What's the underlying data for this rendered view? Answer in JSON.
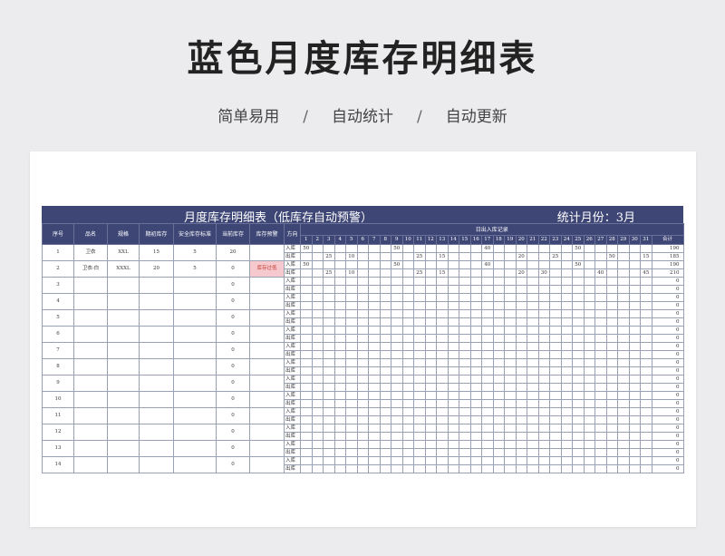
{
  "page": {
    "title": "蓝色月度库存明细表",
    "tagline": [
      "简单易用",
      "自动统计",
      "自动更新"
    ],
    "tagline_sep": "/"
  },
  "sheet": {
    "banner_title": "月度库存明细表（低库存自动预警）",
    "banner_month": "统计月份：3月",
    "headers": {
      "seq": "序号",
      "name": "品名",
      "spec": "规格",
      "initial": "期初库存",
      "safety": "安全库存标准",
      "current": "当前库存",
      "warning": "库存预警",
      "direction": "方向",
      "records": "日出入库记录",
      "total": "合计"
    },
    "days": [
      "1",
      "2",
      "3",
      "4",
      "5",
      "6",
      "7",
      "8",
      "9",
      "10",
      "11",
      "12",
      "13",
      "14",
      "15",
      "16",
      "17",
      "18",
      "19",
      "20",
      "21",
      "22",
      "23",
      "24",
      "25",
      "26",
      "27",
      "28",
      "29",
      "30",
      "31"
    ],
    "dir_labels": [
      "入库",
      "出库"
    ],
    "items": [
      {
        "seq": "1",
        "name": "卫衣",
        "spec": "XXL",
        "initial": "15",
        "safety": "5",
        "current": "20",
        "warning": "",
        "in": {
          "1": "50",
          "9": "50",
          "17": "40",
          "25": "50"
        },
        "out": {
          "3": "25",
          "5": "10",
          "11": "25",
          "13": "15",
          "20": "20",
          "23": "25",
          "28": "50",
          "31": "15"
        },
        "in_total": "190",
        "out_total": "185"
      },
      {
        "seq": "2",
        "name": "卫衣-白",
        "spec": "XXXL",
        "initial": "20",
        "safety": "5",
        "current": "0",
        "warning": "库存过低",
        "in": {
          "1": "50",
          "9": "50",
          "17": "40",
          "25": "50"
        },
        "out": {
          "3": "25",
          "5": "10",
          "11": "25",
          "13": "15",
          "20": "20",
          "22": "30",
          "27": "40",
          "31": "45"
        },
        "in_total": "190",
        "out_total": "210"
      },
      {
        "seq": "3",
        "name": "",
        "spec": "",
        "initial": "",
        "safety": "",
        "current": "0",
        "warning": "",
        "in": {},
        "out": {},
        "in_total": "0",
        "out_total": "0"
      },
      {
        "seq": "4",
        "name": "",
        "spec": "",
        "initial": "",
        "safety": "",
        "current": "0",
        "warning": "",
        "in": {},
        "out": {},
        "in_total": "0",
        "out_total": "0"
      },
      {
        "seq": "5",
        "name": "",
        "spec": "",
        "initial": "",
        "safety": "",
        "current": "0",
        "warning": "",
        "in": {},
        "out": {},
        "in_total": "0",
        "out_total": "0"
      },
      {
        "seq": "6",
        "name": "",
        "spec": "",
        "initial": "",
        "safety": "",
        "current": "0",
        "warning": "",
        "in": {},
        "out": {},
        "in_total": "0",
        "out_total": "0"
      },
      {
        "seq": "7",
        "name": "",
        "spec": "",
        "initial": "",
        "safety": "",
        "current": "0",
        "warning": "",
        "in": {},
        "out": {},
        "in_total": "0",
        "out_total": "0"
      },
      {
        "seq": "8",
        "name": "",
        "spec": "",
        "initial": "",
        "safety": "",
        "current": "0",
        "warning": "",
        "in": {},
        "out": {},
        "in_total": "0",
        "out_total": "0"
      },
      {
        "seq": "9",
        "name": "",
        "spec": "",
        "initial": "",
        "safety": "",
        "current": "0",
        "warning": "",
        "in": {},
        "out": {},
        "in_total": "0",
        "out_total": "0"
      },
      {
        "seq": "10",
        "name": "",
        "spec": "",
        "initial": "",
        "safety": "",
        "current": "0",
        "warning": "",
        "in": {},
        "out": {},
        "in_total": "0",
        "out_total": "0"
      },
      {
        "seq": "11",
        "name": "",
        "spec": "",
        "initial": "",
        "safety": "",
        "current": "0",
        "warning": "",
        "in": {},
        "out": {},
        "in_total": "0",
        "out_total": "0"
      },
      {
        "seq": "12",
        "name": "",
        "spec": "",
        "initial": "",
        "safety": "",
        "current": "0",
        "warning": "",
        "in": {},
        "out": {},
        "in_total": "0",
        "out_total": "0"
      },
      {
        "seq": "13",
        "name": "",
        "spec": "",
        "initial": "",
        "safety": "",
        "current": "0",
        "warning": "",
        "in": {},
        "out": {},
        "in_total": "0",
        "out_total": "0"
      },
      {
        "seq": "14",
        "name": "",
        "spec": "",
        "initial": "",
        "safety": "",
        "current": "0",
        "warning": "",
        "in": {},
        "out": {},
        "in_total": "0",
        "out_total": "0"
      }
    ]
  },
  "colors": {
    "header_bg": "#3e4676",
    "warning_bg": "#f6c9cf",
    "warning_text": "#c0392b"
  }
}
